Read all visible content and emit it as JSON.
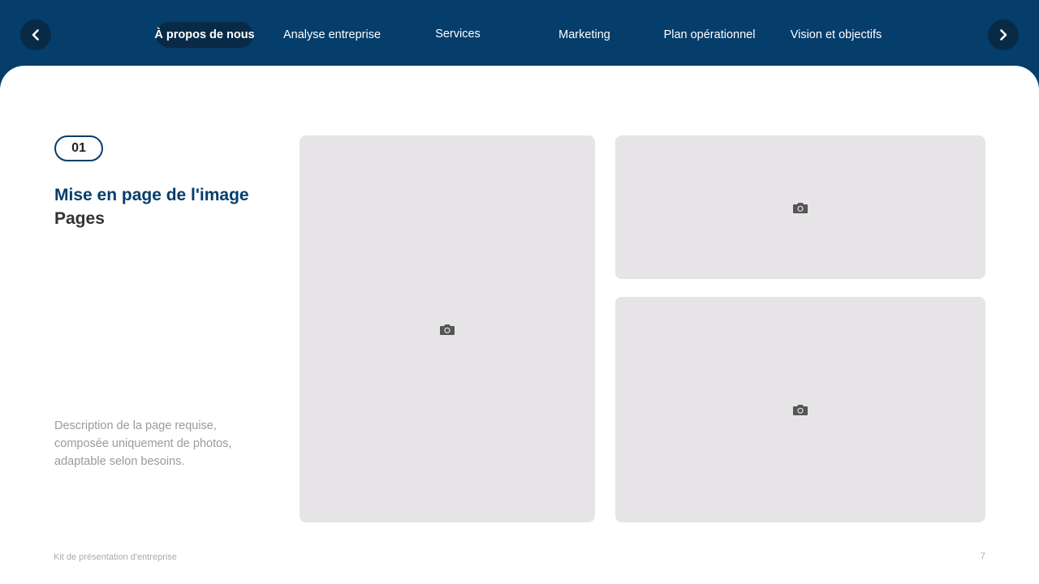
{
  "nav": {
    "tabs": [
      {
        "label": "À propos de nous",
        "active": true
      },
      {
        "label": "Analyse entreprise",
        "active": false
      },
      {
        "label": "Services",
        "active": false
      },
      {
        "label": "Marketing",
        "active": false
      },
      {
        "label": "Plan opérationnel",
        "active": false
      },
      {
        "label": "Vision et objectifs",
        "active": false
      }
    ],
    "prev_icon": "chevron-left-icon",
    "next_icon": "chevron-right-icon"
  },
  "section": {
    "number": "01",
    "title_line1": "Mise en page de l'image",
    "title_line2": "Pages",
    "description": "Description de la page requise, composée uniquement de photos, adaptable selon besoins."
  },
  "photos": {
    "placeholder_icon": "camera-icon"
  },
  "footer": {
    "text": "Kit de présentation d'entreprise",
    "page_number": "7"
  },
  "colors": {
    "header_bg": "#053d6b",
    "active_tab_bg": "#082a47",
    "title_accent": "#053d6b",
    "placeholder_bg": "#e6e4e7"
  }
}
